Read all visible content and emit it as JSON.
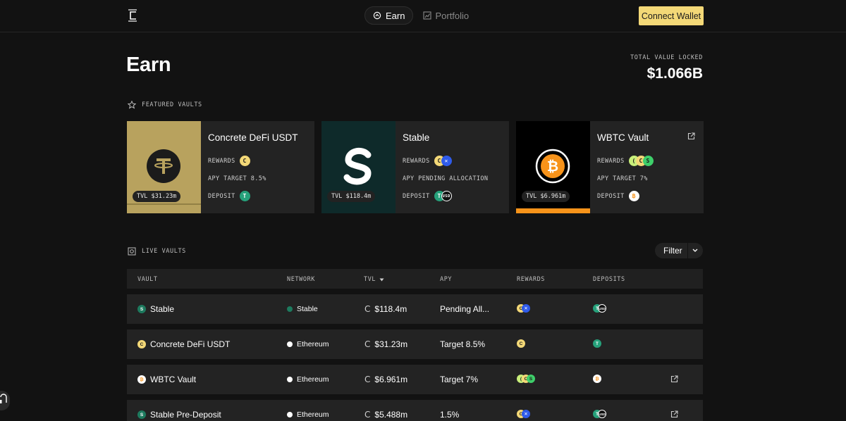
{
  "header": {
    "nav": {
      "earn": "Earn",
      "portfolio": "Portfolio"
    },
    "connect_wallet": "Connect Wallet"
  },
  "page": {
    "title": "Earn",
    "tvl_label": "TOTAL VALUE LOCKED",
    "tvl_value": "$1.066B"
  },
  "featured": {
    "label": "FEATURED VAULTS",
    "cards": [
      {
        "name": "Concrete DeFi USDT",
        "tvl": "TVL $31.23m",
        "rewards_label": "REWARDS",
        "apy": "APY TARGET 8.5%",
        "deposit_label": "DEPOSIT",
        "art_color": "#b8a25e"
      },
      {
        "name": "Stable",
        "tvl": "TVL $118.4m",
        "rewards_label": "REWARDS",
        "apy": "APY PENDING ALLOCATION",
        "deposit_label": "DEPOSIT",
        "art_color": "#0e2a2a"
      },
      {
        "name": "WBTC Vault",
        "tvl": "TVL $6.961m",
        "rewards_label": "REWARDS",
        "apy": "APY TARGET 7%",
        "deposit_label": "DEPOSIT",
        "art_color": "#000000"
      }
    ]
  },
  "live": {
    "label": "LIVE VAULTS",
    "filter": "Filter",
    "columns": {
      "vault": "VAULT",
      "network": "NETWORK",
      "tvl": "TVL",
      "apy": "APY",
      "rewards": "REWARDS",
      "deposits": "DEPOSITS"
    },
    "rows": [
      {
        "vault": "Stable",
        "network": "Stable",
        "tvl": "$118.4m",
        "apy": "Pending All..."
      },
      {
        "vault": "Concrete DeFi USDT",
        "network": "Ethereum",
        "tvl": "$31.23m",
        "apy": "Target 8.5%"
      },
      {
        "vault": "WBTC Vault",
        "network": "Ethereum",
        "tvl": "$6.961m",
        "apy": "Target 7%"
      },
      {
        "vault": "Stable Pre-Deposit",
        "network": "Ethereum",
        "tvl": "$5.488m",
        "apy": "1.5%"
      }
    ]
  },
  "colors": {
    "accent_yellow": "#f3d877",
    "tether_green": "#26a17b",
    "btc_orange": "#f7931a",
    "stable_teal": "#0e2a2a"
  },
  "icons": [
    "concrete-logo-icon",
    "earn-icon",
    "portfolio-icon",
    "star-icon",
    "vault-icon",
    "external-link-icon",
    "chevron-down-icon",
    "sort-down-icon",
    "tether-icon",
    "bitcoin-icon",
    "stable-icon",
    "support-icon"
  ]
}
